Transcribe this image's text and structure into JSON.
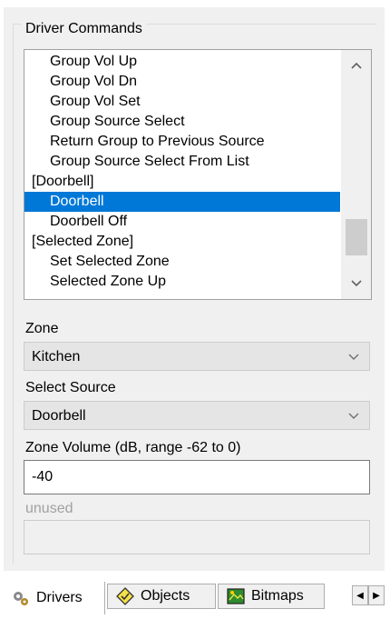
{
  "driver_commands": {
    "title": "Driver Commands",
    "items": [
      {
        "label": "Group Vol Up",
        "kind": "command",
        "selected": false
      },
      {
        "label": "Group Vol Dn",
        "kind": "command",
        "selected": false
      },
      {
        "label": "Group Vol Set",
        "kind": "command",
        "selected": false
      },
      {
        "label": "Group Source Select",
        "kind": "command",
        "selected": false
      },
      {
        "label": "Return Group to Previous Source",
        "kind": "command",
        "selected": false
      },
      {
        "label": "Group Source Select From List",
        "kind": "command",
        "selected": false
      },
      {
        "label": "[Doorbell]",
        "kind": "category",
        "selected": false
      },
      {
        "label": "Doorbell",
        "kind": "command",
        "selected": true
      },
      {
        "label": "Doorbell Off",
        "kind": "command",
        "selected": false
      },
      {
        "label": "[Selected Zone]",
        "kind": "category",
        "selected": false
      },
      {
        "label": "Set Selected Zone",
        "kind": "command",
        "selected": false
      },
      {
        "label": "Selected Zone Up",
        "kind": "command",
        "selected": false
      }
    ]
  },
  "zone": {
    "label": "Zone",
    "value": "Kitchen"
  },
  "select_source": {
    "label": "Select Source",
    "value": "Doorbell"
  },
  "zone_volume": {
    "label": "Zone Volume (dB, range -62 to 0)",
    "value": "-40"
  },
  "unused": {
    "label": "unused",
    "value": ""
  },
  "tabs": [
    {
      "label": "Drivers",
      "icon": "drivers-icon",
      "active": true
    },
    {
      "label": "Objects",
      "icon": "objects-icon",
      "active": false
    },
    {
      "label": "Bitmaps",
      "icon": "bitmaps-icon",
      "active": false
    }
  ],
  "colors": {
    "selection": "#0078d7",
    "panel": "#f0f0f0"
  }
}
